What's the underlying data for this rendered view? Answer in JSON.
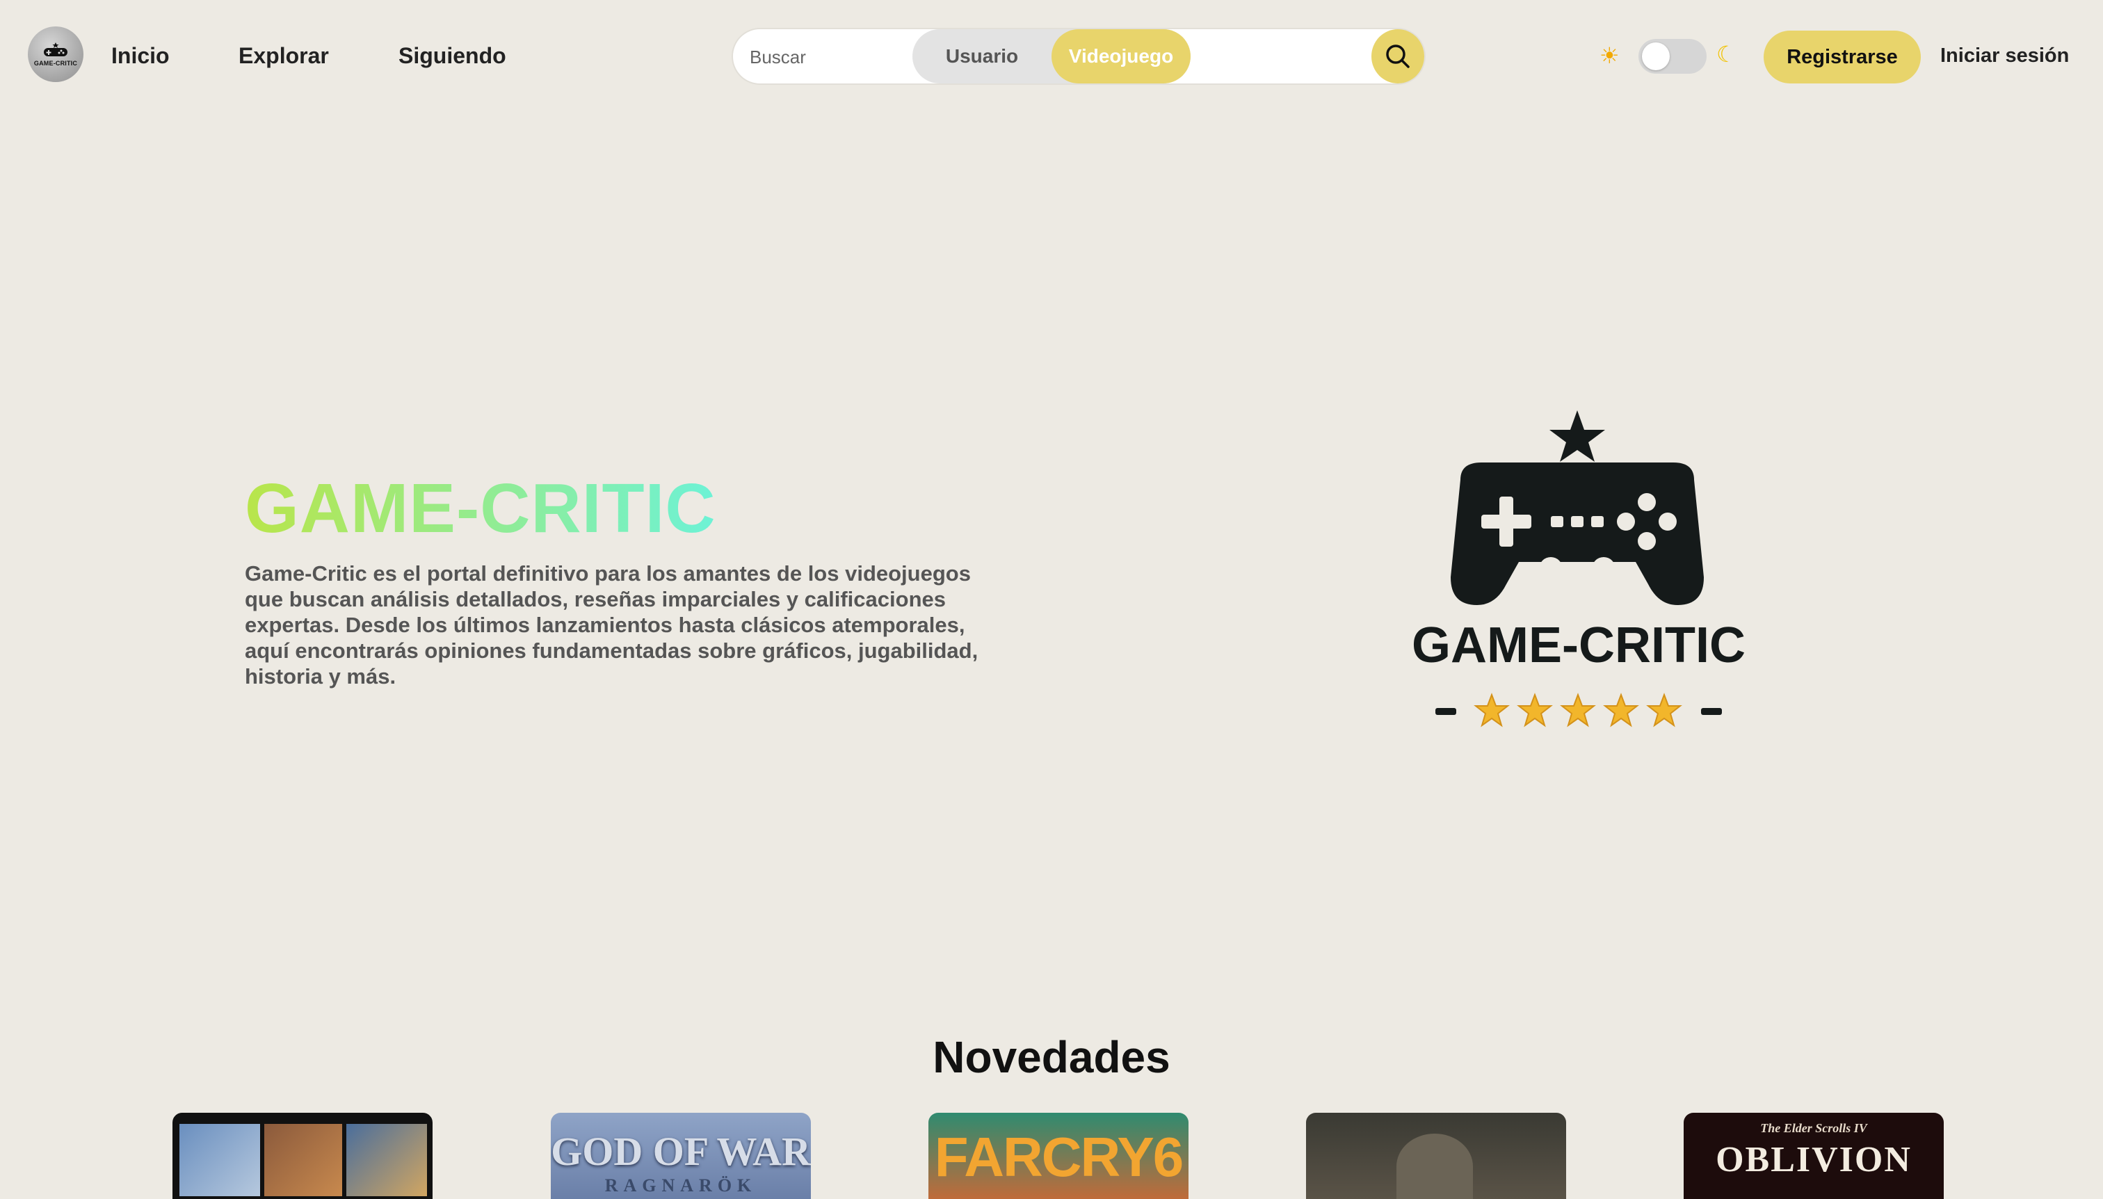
{
  "header": {
    "logo_text": "GAME-CRITIC",
    "nav": [
      {
        "label": "Inicio"
      },
      {
        "label": "Explorar"
      },
      {
        "label": "Siguiendo"
      }
    ],
    "search": {
      "placeholder": "Buscar",
      "segments": [
        "Usuario",
        "Videojuego"
      ],
      "selected": "Videojuego",
      "button_icon": "search-icon"
    },
    "theme_toggle": {
      "light_icon": "sun-icon",
      "dark_icon": "moon-icon",
      "state": "light"
    },
    "register_label": "Registrarse",
    "login_label": "Iniciar sesión"
  },
  "hero": {
    "title": "GAME-CRITIC",
    "description": "Game-Critic es el portal definitivo para los amantes de los videojuegos que buscan análisis detallados, reseñas imparciales y calificaciones expertas. Desde los últimos lanzamientos hasta clásicos atemporales, aquí encontrarás opiniones fundamentadas sobre gráficos, jugabilidad, historia y más.",
    "logo_text": "GAME-CRITIC",
    "logo_stars": 5
  },
  "novedades": {
    "title": "Novedades",
    "games": [
      {
        "cover_text": ""
      },
      {
        "cover_text": "GOD OF WAR",
        "cover_subtext": "RAGNARÖK"
      },
      {
        "cover_text": "FARCRY6"
      },
      {
        "cover_text": ""
      },
      {
        "cover_text": "OBLIVION",
        "cover_subtext": "The Elder Scrolls IV"
      }
    ]
  },
  "colors": {
    "background": "#edeae3",
    "accent": "#e8d46b",
    "title_gradient_start": "#b9e54a",
    "title_gradient_end": "#6df2d6"
  }
}
